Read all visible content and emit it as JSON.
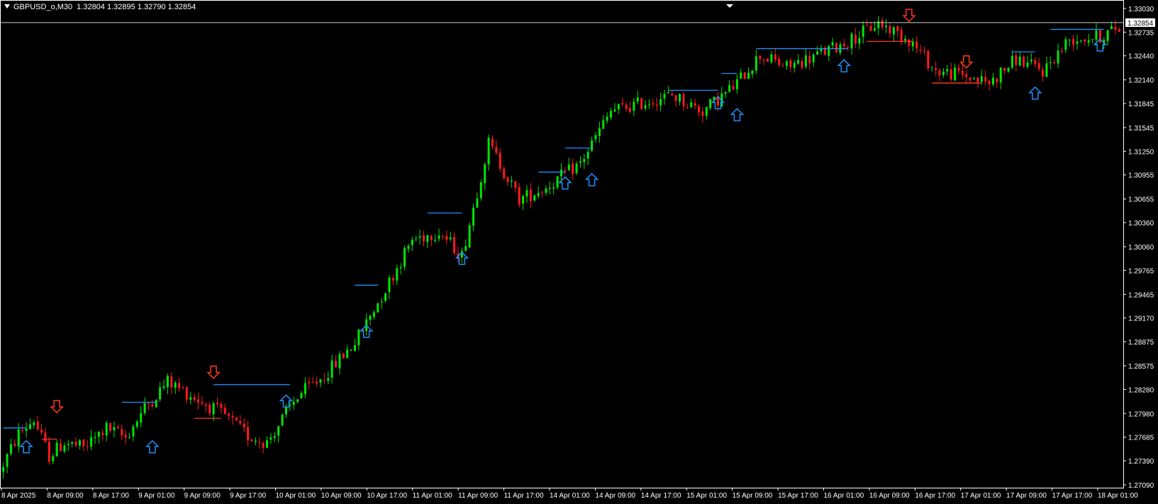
{
  "header": {
    "symbol": "GBPUSD_o,M30",
    "ohlc": "1.32804 1.32895 1.32790 1.32854"
  },
  "colors": {
    "background": "#000000",
    "bull": "#00e600",
    "bear": "#ff1a1a",
    "axis": "#ffffff",
    "resistance": "#1e90ff",
    "support": "#ff3b1a",
    "buy_arrow": "#1e90ff",
    "sell_arrow": "#ff3b1a"
  },
  "chart_data": {
    "type": "candlestick",
    "symbol": "GBPUSD_o",
    "timeframe": "M30",
    "current_price": "1.32854",
    "ylim": [
      1.27,
      1.3318
    ],
    "y_ticks": [
      "1.33030",
      "1.32735",
      "1.32440",
      "1.32140",
      "1.31845",
      "1.31545",
      "1.31250",
      "1.30955",
      "1.30655",
      "1.30360",
      "1.30060",
      "1.29765",
      "1.29465",
      "1.29170",
      "1.28875",
      "1.28575",
      "1.28280",
      "1.27980",
      "1.27685",
      "1.27390",
      "1.27090"
    ],
    "x_ticks": [
      "8 Apr 2025",
      "8 Apr 09:00",
      "8 Apr 17:00",
      "9 Apr 01:00",
      "9 Apr 09:00",
      "9 Apr 17:00",
      "10 Apr 01:00",
      "10 Apr 09:00",
      "10 Apr 17:00",
      "11 Apr 01:00",
      "11 Apr 09:00",
      "11 Apr 17:00",
      "14 Apr 01:00",
      "14 Apr 09:00",
      "14 Apr 17:00",
      "15 Apr 01:00",
      "15 Apr 09:00",
      "15 Apr 17:00",
      "16 Apr 01:00",
      "16 Apr 09:00",
      "16 Apr 17:00",
      "17 Apr 01:00",
      "17 Apr 09:00",
      "17 Apr 17:00",
      "18 Apr 01:00"
    ],
    "price_path": [
      [
        0,
        1.2725
      ],
      [
        5,
        1.2773
      ],
      [
        9,
        1.279
      ],
      [
        13,
        1.2745
      ],
      [
        17,
        1.2762
      ],
      [
        22,
        1.2755
      ],
      [
        28,
        1.278
      ],
      [
        33,
        1.2768
      ],
      [
        38,
        1.2805
      ],
      [
        44,
        1.2838
      ],
      [
        52,
        1.2815
      ],
      [
        59,
        1.2795
      ],
      [
        65,
        1.277
      ],
      [
        70,
        1.2762
      ],
      [
        78,
        1.282
      ],
      [
        85,
        1.2845
      ],
      [
        93,
        1.2887
      ],
      [
        100,
        1.2945
      ],
      [
        108,
        1.3015
      ],
      [
        115,
        1.3025
      ],
      [
        121,
        1.2995
      ],
      [
        128,
        1.3135
      ],
      [
        136,
        1.3065
      ],
      [
        143,
        1.308
      ],
      [
        152,
        1.311
      ],
      [
        160,
        1.3175
      ],
      [
        168,
        1.3185
      ],
      [
        176,
        1.3195
      ],
      [
        184,
        1.3175
      ],
      [
        192,
        1.3205
      ],
      [
        199,
        1.3245
      ],
      [
        206,
        1.323
      ],
      [
        214,
        1.3245
      ],
      [
        222,
        1.3262
      ],
      [
        230,
        1.3285
      ],
      [
        238,
        1.3265
      ],
      [
        245,
        1.3225
      ],
      [
        252,
        1.322
      ],
      [
        259,
        1.321
      ],
      [
        266,
        1.324
      ],
      [
        273,
        1.3225
      ],
      [
        280,
        1.3265
      ],
      [
        288,
        1.3268
      ],
      [
        292,
        1.3278
      ]
    ],
    "resistance_lines": [
      {
        "from": 0,
        "to": 6,
        "price": 1.278
      },
      {
        "from": 31,
        "to": 40,
        "price": 1.2812
      },
      {
        "from": 55,
        "to": 75,
        "price": 1.2834
      },
      {
        "from": 92,
        "to": 98,
        "price": 1.2958
      },
      {
        "from": 111,
        "to": 120,
        "price": 1.3048
      },
      {
        "from": 140,
        "to": 147,
        "price": 1.3099
      },
      {
        "from": 147,
        "to": 154,
        "price": 1.3129
      },
      {
        "from": 174,
        "to": 187,
        "price": 1.3201
      },
      {
        "from": 188,
        "to": 192,
        "price": 1.3222
      },
      {
        "from": 197,
        "to": 221,
        "price": 1.3253
      },
      {
        "from": 264,
        "to": 270,
        "price": 1.3249
      },
      {
        "from": 274,
        "to": 288,
        "price": 1.3277
      }
    ],
    "support_lines": [
      {
        "from": 10,
        "to": 14,
        "price": 1.2766
      },
      {
        "from": 50,
        "to": 57,
        "price": 1.2792
      },
      {
        "from": 226,
        "to": 238,
        "price": 1.3262
      },
      {
        "from": 243,
        "to": 256,
        "price": 1.321
      }
    ],
    "buy_arrows": [
      {
        "bar": 6,
        "price": 1.2764
      },
      {
        "bar": 39,
        "price": 1.2764
      },
      {
        "bar": 74,
        "price": 1.2821
      },
      {
        "bar": 95,
        "price": 1.2908
      },
      {
        "bar": 120,
        "price": 1.2999
      },
      {
        "bar": 147,
        "price": 1.3093
      },
      {
        "bar": 154,
        "price": 1.3097
      },
      {
        "bar": 187,
        "price": 1.3193
      },
      {
        "bar": 192,
        "price": 1.3178
      },
      {
        "bar": 220,
        "price": 1.3239
      },
      {
        "bar": 270,
        "price": 1.3205
      },
      {
        "bar": 287,
        "price": 1.3265
      }
    ],
    "sell_arrows": [
      {
        "bar": 14,
        "price": 1.2799
      },
      {
        "bar": 55,
        "price": 1.2842
      },
      {
        "bar": 237,
        "price": 1.3287
      },
      {
        "bar": 252,
        "price": 1.3229
      }
    ]
  }
}
